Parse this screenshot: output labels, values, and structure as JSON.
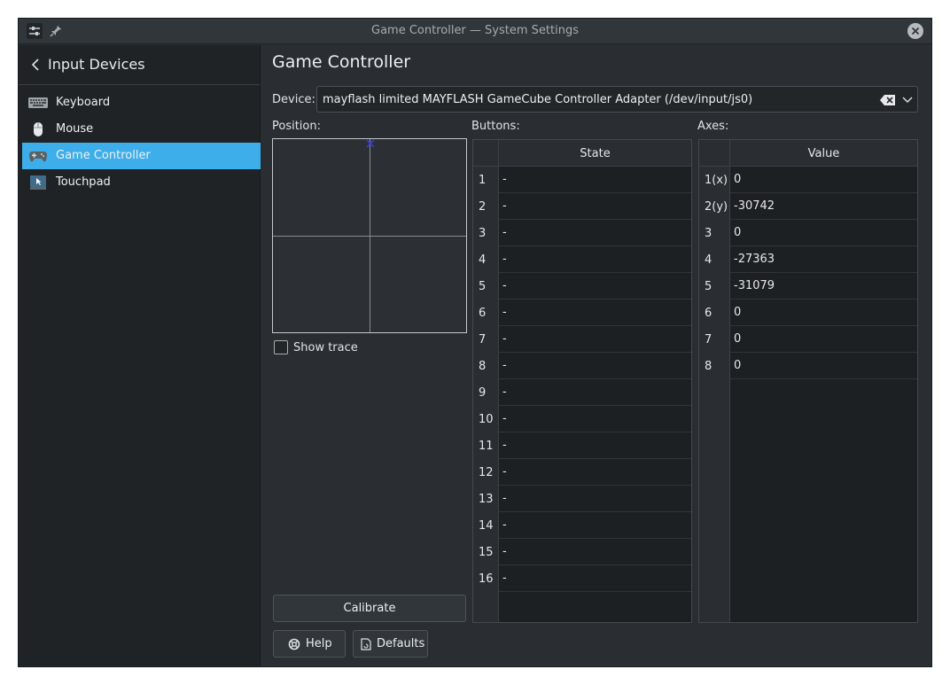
{
  "window": {
    "title": "Game Controller — System Settings"
  },
  "sidebar": {
    "back_label": "Input Devices",
    "items": [
      {
        "label": "Keyboard",
        "icon": "keyboard-icon"
      },
      {
        "label": "Mouse",
        "icon": "mouse-icon"
      },
      {
        "label": "Game Controller",
        "icon": "gamepad-icon",
        "selected": true
      },
      {
        "label": "Touchpad",
        "icon": "touchpad-icon"
      }
    ]
  },
  "main": {
    "title": "Game Controller",
    "device": {
      "label": "Device:",
      "value": "mayflash limited MAYFLASH GameCube Controller Adapter (/dev/input/js0)"
    },
    "position": {
      "label": "Position:",
      "x_value": 0,
      "y_value": -30742
    },
    "show_trace": {
      "label": "Show trace",
      "checked": false
    },
    "calibrate_label": "Calibrate",
    "buttons": {
      "label": "Buttons:",
      "header": "State",
      "rows": [
        {
          "id": "1",
          "state": "-"
        },
        {
          "id": "2",
          "state": "-"
        },
        {
          "id": "3",
          "state": "-"
        },
        {
          "id": "4",
          "state": "-"
        },
        {
          "id": "5",
          "state": "-"
        },
        {
          "id": "6",
          "state": "-"
        },
        {
          "id": "7",
          "state": "-"
        },
        {
          "id": "8",
          "state": "-"
        },
        {
          "id": "9",
          "state": "-"
        },
        {
          "id": "10",
          "state": "-"
        },
        {
          "id": "11",
          "state": "-"
        },
        {
          "id": "12",
          "state": "-"
        },
        {
          "id": "13",
          "state": "-"
        },
        {
          "id": "14",
          "state": "-"
        },
        {
          "id": "15",
          "state": "-"
        },
        {
          "id": "16",
          "state": "-"
        }
      ]
    },
    "axes": {
      "label": "Axes:",
      "header": "Value",
      "rows": [
        {
          "id": "1(x)",
          "value": "0"
        },
        {
          "id": "2(y)",
          "value": "-30742"
        },
        {
          "id": "3",
          "value": "0"
        },
        {
          "id": "4",
          "value": "-27363"
        },
        {
          "id": "5",
          "value": "-31079"
        },
        {
          "id": "6",
          "value": "0"
        },
        {
          "id": "7",
          "value": "0"
        },
        {
          "id": "8",
          "value": "0"
        }
      ]
    }
  },
  "footer": {
    "help_label": "Help",
    "defaults_label": "Defaults"
  },
  "colors": {
    "accent": "#3daee9",
    "background": "#2a2e32",
    "marker": "#3c3cf0"
  }
}
